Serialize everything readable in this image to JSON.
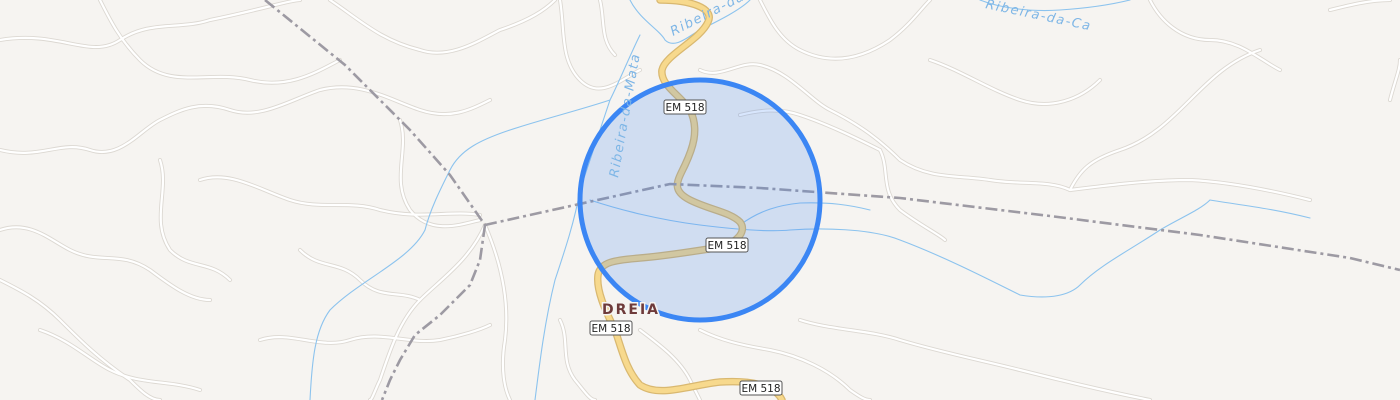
{
  "map": {
    "colors": {
      "land": "#f6f4f1",
      "minor_road": "#ffffff",
      "minor_road_casing": "#dcd8d2",
      "main_road": "#f7d98d",
      "main_road_casing": "#d9b870",
      "river": "#8cc3ee",
      "boundary": "#9d9aa3",
      "marker_fill": "#3b82f6",
      "marker_stroke": "#3b86f4"
    },
    "road_shields": [
      {
        "label": "EM 518"
      },
      {
        "label": "EM 518"
      },
      {
        "label": "EM 518"
      },
      {
        "label": "EM 518"
      }
    ],
    "rivers": [
      {
        "label": "Ribeira-da-Mata"
      },
      {
        "label": "Ribeira-da-Ca"
      },
      {
        "label": "Ribeira-da-Ca"
      }
    ],
    "places": [
      {
        "label": "DREIA"
      }
    ],
    "marker": {
      "type": "location-accuracy-circle"
    }
  }
}
